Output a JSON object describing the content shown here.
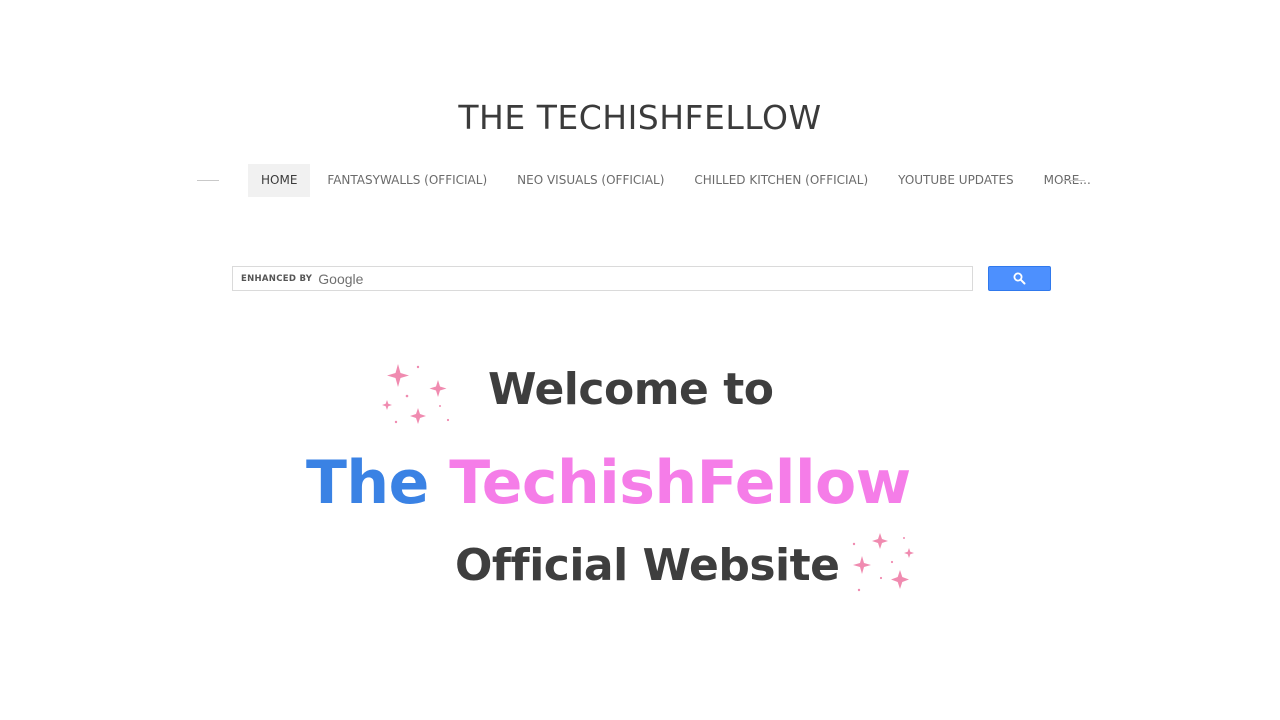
{
  "header": {
    "title": "THE TECHISHFELLOW"
  },
  "nav": {
    "items": [
      {
        "label": "HOME",
        "active": true
      },
      {
        "label": "FANTASYWALLS (OFFICIAL)"
      },
      {
        "label": "NEO VISUALS (OFFICIAL)"
      },
      {
        "label": "CHILLED KITCHEN (OFFICIAL)"
      },
      {
        "label": "YOUTUBE UPDATES"
      },
      {
        "label": "MORE..."
      }
    ]
  },
  "search": {
    "enhanced_label": "ENHANCED BY",
    "brand_label": "Google",
    "button_icon": "search-icon"
  },
  "banner": {
    "line1": "Welcome to",
    "line2_part1": "The",
    "line2_part2": "TechishFellow",
    "line3": "Official Website",
    "sparkle_color": "#f08bb0",
    "the_color": "#3a82e4",
    "name_color": "#f57de8"
  }
}
